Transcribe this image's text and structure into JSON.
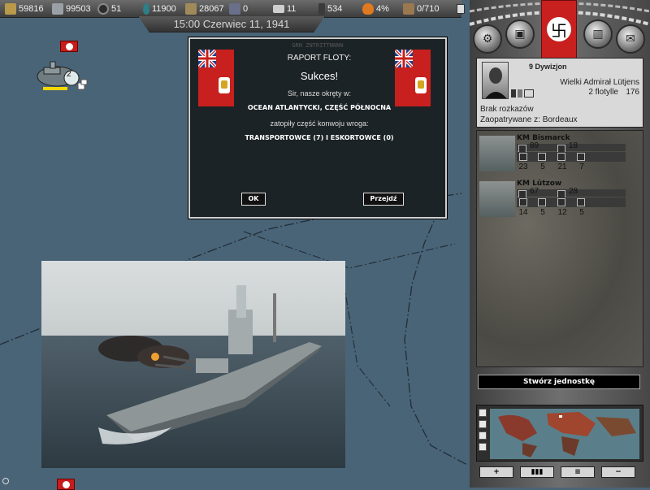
{
  "resources": [
    {
      "icon": "gold-icon",
      "value": "59816"
    },
    {
      "icon": "steel-icon",
      "value": "99503"
    },
    {
      "icon": "rubber-icon",
      "value": "51"
    },
    {
      "icon": "oil-icon",
      "value": "11900"
    },
    {
      "icon": "manpower-icon",
      "value": "28067"
    },
    {
      "icon": "crossed-swords-icon",
      "value": "0"
    },
    {
      "icon": "mail-icon",
      "value": "11"
    },
    {
      "icon": "soldier-icon",
      "value": "534"
    },
    {
      "icon": "morale-icon",
      "value": "4%"
    },
    {
      "icon": "supply-icon",
      "value": "0/710"
    }
  ],
  "date": "15:00 Czerwiec 11, 1941",
  "map": {
    "unit_count": "2"
  },
  "dialog": {
    "subtitle": "GRN ZNTRITTNNNN",
    "title": "RAPORT FLOTY:",
    "headline": "Sukces!",
    "intro": "Sir, nasze okręty w:",
    "location": "OCEAN ATLANTYCKI, CZĘŚĆ PÓŁNOCNA",
    "middle": "zatopiły część konwoju wroga:",
    "losses": "TRANSPORTOWCE (7) I ESKORTOWCE (0)",
    "ok_label": "OK",
    "goto_label": "Przejdź"
  },
  "panel": {
    "division": "9 Dywizjon",
    "commander": "Wielki Admirał Lütjens",
    "flotillas": "2 flotylle",
    "strength": "176",
    "orders": "Brak rozkazów",
    "supply": "Zaopatrywane z: Bordeaux",
    "units": [
      {
        "name": "KM Bismarck",
        "stat1": "89",
        "stat2": "18",
        "values": [
          "23",
          "5",
          "21",
          "7"
        ]
      },
      {
        "name": "KM Lützow",
        "stat1": "67",
        "stat2": "28",
        "values": [
          "14",
          "5",
          "12",
          "5"
        ]
      }
    ],
    "create_label": "Stwórz jednostkę",
    "bottom_buttons": [
      "+",
      "",
      "",
      "−"
    ]
  },
  "colors": {
    "sea": "#4a6477",
    "flag_red": "#c8201e",
    "ensign_blue": "#1f3f8e"
  }
}
